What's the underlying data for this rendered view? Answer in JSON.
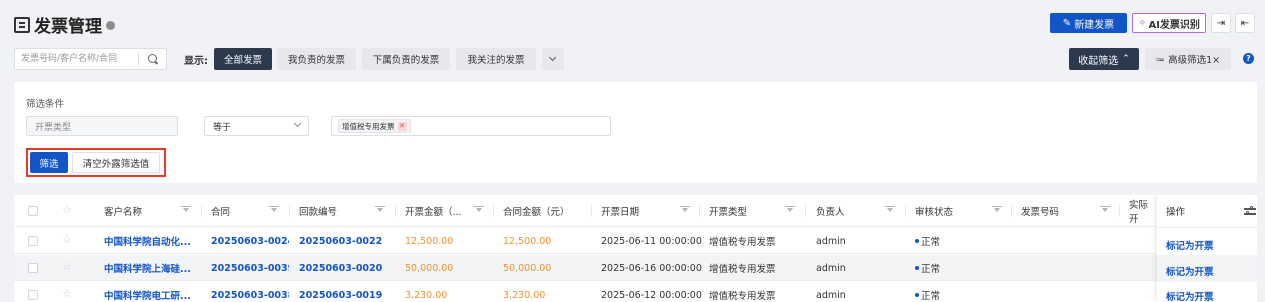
{
  "header": {
    "title": "发票管理",
    "new_button": "新建发票",
    "ai_button": "AI发票识别"
  },
  "toolbar": {
    "search_placeholder": "发票号码/客户名称/合同",
    "display_label": "显示:",
    "tabs": [
      "全部发票",
      "我负责的发票",
      "下属负责的发票",
      "我关注的发票"
    ],
    "active_tab": "全部发票",
    "collapse_label": "收起筛选",
    "advanced_label": "高级筛选1×"
  },
  "filter": {
    "section_label": "筛选条件",
    "field": "开票类型",
    "operator": "等于",
    "value_tag": "增值税专用发票",
    "apply_label": "筛选",
    "clear_label": "清空外露筛选值"
  },
  "table": {
    "columns": [
      "客户名称",
      "合同",
      "回款编号",
      "开票金额（...",
      "合同金额（元）",
      "开票日期",
      "开票类型",
      "负责人",
      "审核状态",
      "发票号码",
      "实际开",
      "操作"
    ],
    "rows": [
      {
        "customer": "中国科学院自动化...",
        "contract": "20250603-0024...",
        "payment_no": "20250603-0022",
        "invoice_amount": "12,500.00",
        "contract_amount": "12,500.00",
        "date": "2025-06-11 00:00:00",
        "type": "增值税专用发票",
        "owner": "admin",
        "status": "正常",
        "invoice_no": "",
        "action": "标记为开票"
      },
      {
        "customer": "中国科学院上海硅...",
        "contract": "20250603-0039",
        "payment_no": "20250603-0020",
        "invoice_amount": "50,000.00",
        "contract_amount": "50,000.00",
        "date": "2025-06-16 00:00:00",
        "type": "增值税专用发票",
        "owner": "admin",
        "status": "正常",
        "invoice_no": "",
        "action": "标记为开票"
      },
      {
        "customer": "中国科学院电工研...",
        "contract": "20250603-0038",
        "payment_no": "20250603-0019",
        "invoice_amount": "3,230.00",
        "contract_amount": "3,230.00",
        "date": "2025-06-12 00:00:00",
        "type": "增值税专用发票",
        "owner": "admin",
        "status": "正常",
        "invoice_no": "",
        "action": "标记为开票"
      }
    ]
  },
  "colors": {
    "primary": "#1354c6",
    "dark": "#2d3a4d",
    "amount": "#f0922e",
    "highlight": "#e8392c"
  }
}
